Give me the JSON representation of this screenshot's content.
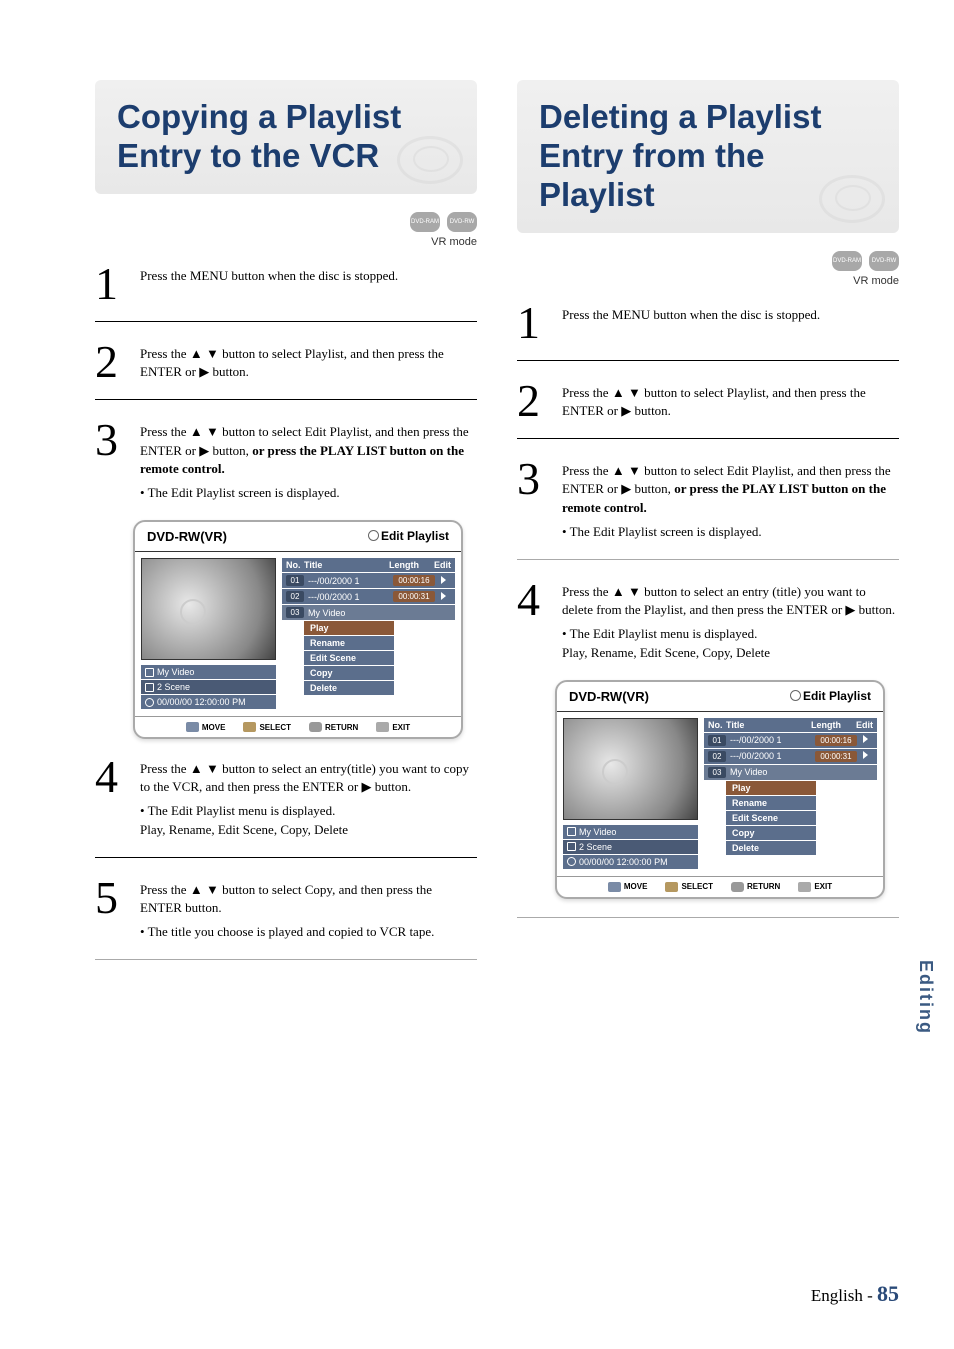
{
  "left": {
    "title": "Copying a Playlist Entry to the VCR",
    "badge1": "DVD-RAM",
    "badge2": "DVD-RW",
    "mode": "VR mode",
    "steps": [
      {
        "n": "1",
        "text": "Press the MENU button when the disc is stopped."
      },
      {
        "n": "2",
        "text": "Press the ▲ ▼ button to select Playlist, and then press the ENTER or ▶ button."
      },
      {
        "n": "3",
        "text": "Press the ▲ ▼ button to select Edit Playlist, and then press the ENTER or ▶ button,",
        "bold": "or press the PLAY LIST button on the remote control.",
        "bullet": "• The Edit Playlist screen is displayed."
      },
      {
        "n": "4",
        "text": "Press the ▲ ▼ button to select an entry(title) you want to copy to the VCR, and then press the ENTER or ▶ button.",
        "bullet": "• The Edit Playlist menu is displayed.\n  Play, Rename, Edit Scene, Copy, Delete"
      },
      {
        "n": "5",
        "text": "Press the ▲ ▼ button to select Copy, and then press the ENTER button.",
        "bullet": "• The title you choose is played and copied to VCR tape."
      }
    ]
  },
  "right": {
    "title": "Deleting a Playlist Entry from the Playlist",
    "badge1": "DVD-RAM",
    "badge2": "DVD-RW",
    "mode": "VR mode",
    "steps": [
      {
        "n": "1",
        "text": "Press the MENU button when the disc is stopped."
      },
      {
        "n": "2",
        "text": "Press the ▲ ▼ button to select Playlist, and then press the ENTER or ▶ button."
      },
      {
        "n": "3",
        "text": "Press the ▲ ▼ button to select Edit Playlist, and then press the ENTER or ▶ button,",
        "bold": "or press the PLAY LIST button on the remote control.",
        "bullet": "• The Edit Playlist screen is displayed."
      },
      {
        "n": "4",
        "text": "Press the ▲ ▼ button to select an entry (title) you want to delete from the Playlist, and then press the ENTER or ▶ button.",
        "bullet": "• The Edit Playlist menu is displayed.\n  Play, Rename, Edit Scene, Copy, Delete"
      }
    ]
  },
  "screen": {
    "disc": "DVD-RW(VR)",
    "header_right": "Edit Playlist",
    "cols": {
      "c1": "No.",
      "c2": "Title",
      "c3": "Length",
      "c4": "Edit"
    },
    "rows": [
      {
        "no": "01",
        "title": "---/00/2000 1",
        "len": "00:00:16"
      },
      {
        "no": "02",
        "title": "---/00/2000 1",
        "len": "00:00:31"
      },
      {
        "no": "03",
        "title": "My Video",
        "len": ""
      }
    ],
    "ctx": [
      "Play",
      "Rename",
      "Edit Scene",
      "Copy",
      "Delete"
    ],
    "meta": {
      "title": "My Video",
      "scene": "2 Scene",
      "time": "00/00/00 12:00:00  PM"
    },
    "footer": {
      "move": "MOVE",
      "select": "SELECT",
      "return": "RETURN",
      "exit": "EXIT"
    }
  },
  "side": "Editing",
  "foot": {
    "label": "English - ",
    "page": "85"
  }
}
